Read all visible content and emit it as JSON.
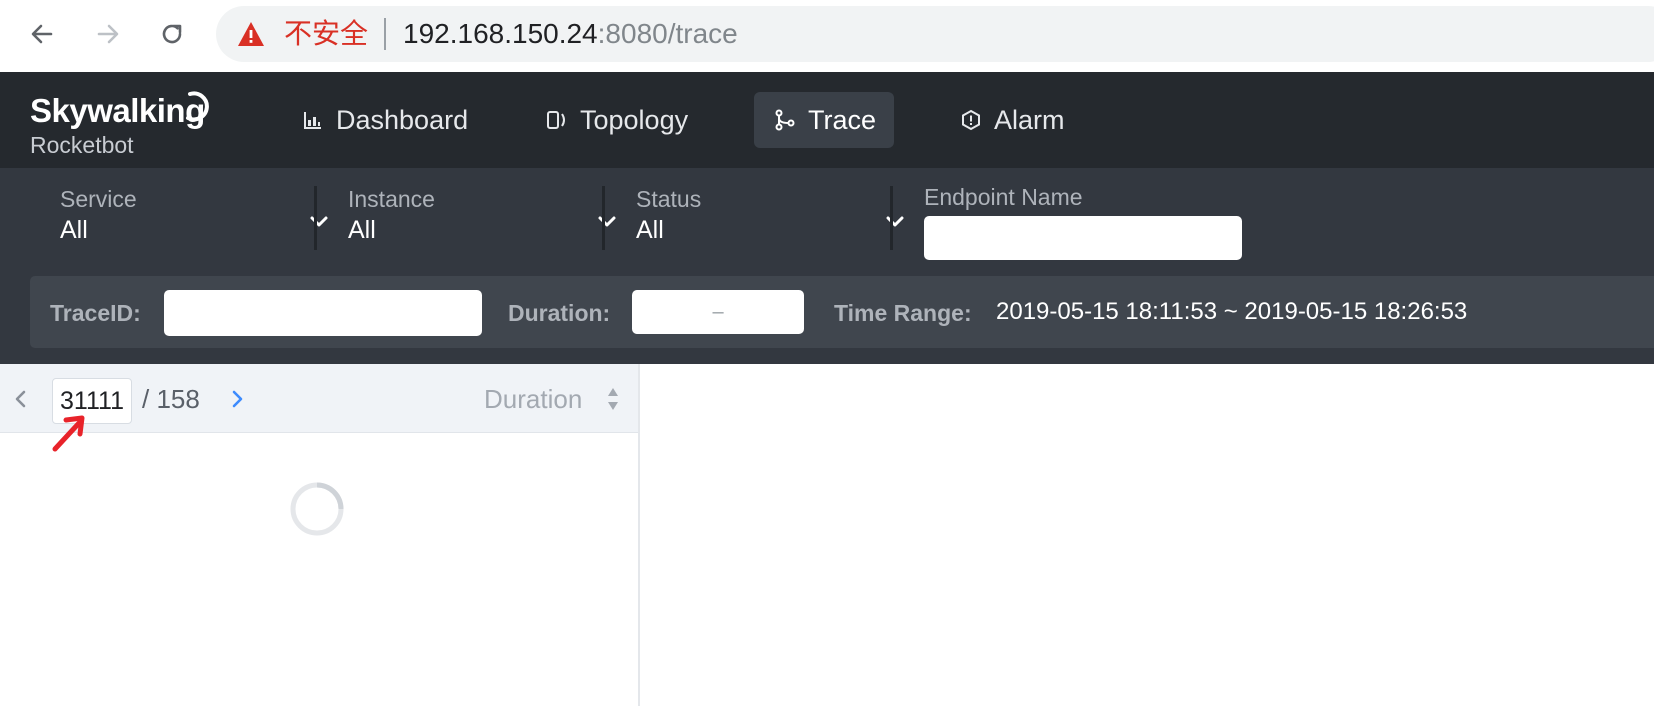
{
  "browser": {
    "insecure_label": "不安全",
    "url_host": "192.168.150.24",
    "url_rest": ":8080/trace"
  },
  "app": {
    "logo_title": "Skywalking",
    "logo_subtitle": "Rocketbot",
    "nav": [
      {
        "label": "Dashboard",
        "icon": "chart-icon"
      },
      {
        "label": "Topology",
        "icon": "topology-icon"
      },
      {
        "label": "Trace",
        "icon": "trace-icon",
        "active": true
      },
      {
        "label": "Alarm",
        "icon": "alarm-icon"
      }
    ]
  },
  "filters": {
    "service": {
      "label": "Service",
      "value": "All"
    },
    "instance": {
      "label": "Instance",
      "value": "All"
    },
    "status": {
      "label": "Status",
      "value": "All"
    },
    "endpoint": {
      "label": "Endpoint Name",
      "value": ""
    },
    "trace_id": {
      "label": "TraceID:",
      "value": ""
    },
    "duration": {
      "label": "Duration:",
      "separator": "–"
    },
    "time_range": {
      "label": "Time Range:",
      "value": "2019-05-15 18:11:53 ~ 2019-05-15 18:26:53"
    }
  },
  "list": {
    "page_current": "31111",
    "page_total": "/ 158",
    "sort_label": "Duration"
  },
  "colors": {
    "header_bg": "#25292e",
    "filter_bg": "#333840",
    "accent_blue": "#3d8bfd",
    "warning_red": "#d93025"
  }
}
